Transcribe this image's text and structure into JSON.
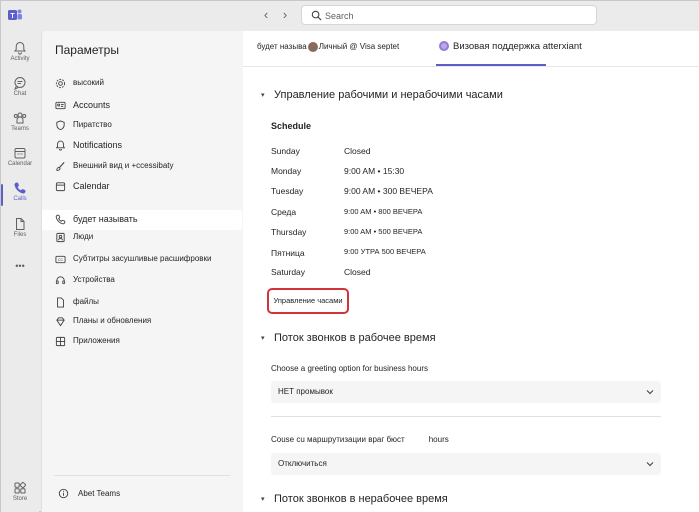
{
  "search": {
    "placeholder": "Search"
  },
  "rail": {
    "items": [
      {
        "label": "Activity"
      },
      {
        "label": "Chat"
      },
      {
        "label": "Teams"
      },
      {
        "label": "Calendar"
      },
      {
        "label": "Calls"
      },
      {
        "label": "Files"
      },
      {
        "label": "Store"
      }
    ],
    "more": "•••"
  },
  "settings": {
    "title": "Параметры",
    "items": [
      {
        "label": "высокий"
      },
      {
        "label": "Accounts"
      },
      {
        "label": "Пиратство"
      },
      {
        "label": "Notifications"
      },
      {
        "label": "Внешний вид и +ccessibaty"
      },
      {
        "label": "Calendar"
      },
      {
        "label": "будет называть"
      },
      {
        "label": "Люди"
      },
      {
        "label": "Субтитры засушливые расшифровки"
      },
      {
        "label": "Устройства"
      },
      {
        "label": "файлы"
      },
      {
        "label": "Планы и обновления"
      },
      {
        "label": "Приложения"
      }
    ],
    "about": "Abet Teams"
  },
  "tabs": [
    {
      "label_a": "будет называ",
      "label_b": "Личный @ Visa septet"
    },
    {
      "label": "Визовая поддержка atterxiant"
    }
  ],
  "sections": {
    "hours_title": "Управление рабочими и нерабочими часами",
    "schedule_title": "Schedule",
    "schedule": [
      {
        "day": "Sunday",
        "hours": "Closed"
      },
      {
        "day": "Monday",
        "hours": "9:00 AM • 15:30"
      },
      {
        "day": "Tuesday",
        "hours": "9:00 AM • 300 ВЕЧЕРА"
      },
      {
        "day": "Среда",
        "hours": "9:00 AM • 800 ВЕЧЕРА"
      },
      {
        "day": "Thursday",
        "hours": "9:00 AM • 500 ВЕЧЕРА"
      },
      {
        "day": "Пятница",
        "hours": "9:00 УТРА 500 ВЕЧЕРА"
      },
      {
        "day": "Saturday",
        "hours": "Closed"
      }
    ],
    "manage_button": "Управление часами",
    "business_flow_title": "Поток звонков в рабочее время",
    "greeting_label": "Choose a greeting option for business hours",
    "greeting_value": "НЕТ промывок",
    "routing_label": "Couse cu маршрутизации враг бюст",
    "routing_label_suffix": "hours",
    "routing_value": "Отключиться",
    "after_hours_title": "Поток звонков в нерабочее время"
  },
  "colors": {
    "accent": "#5b5fc7",
    "highlight": "#d13438"
  }
}
